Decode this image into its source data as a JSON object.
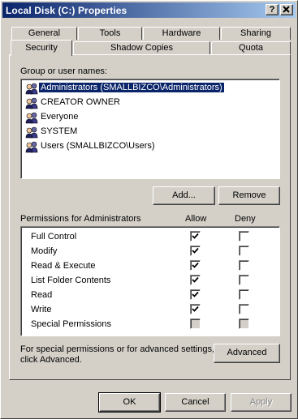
{
  "window": {
    "title": "Local Disk (C:) Properties",
    "help_button": "?",
    "close_button": "X"
  },
  "tabs_row1": [
    {
      "label": "General"
    },
    {
      "label": "Tools"
    },
    {
      "label": "Hardware"
    },
    {
      "label": "Sharing"
    }
  ],
  "tabs_row2": [
    {
      "label": "Security",
      "active": true
    },
    {
      "label": "Shadow Copies"
    },
    {
      "label": "Quota"
    }
  ],
  "security": {
    "group_label": "Group or user names:",
    "users": [
      {
        "name": "Administrators (SMALLBIZCO\\Administrators)",
        "selected": true,
        "icon": "user-group-icon"
      },
      {
        "name": "CREATOR OWNER",
        "icon": "user-group-icon"
      },
      {
        "name": "Everyone",
        "icon": "user-group-icon"
      },
      {
        "name": "SYSTEM",
        "icon": "user-group-icon"
      },
      {
        "name": "Users (SMALLBIZCO\\Users)",
        "icon": "user-group-icon"
      }
    ],
    "add_button": "Add...",
    "remove_button": "Remove",
    "permissions_label": "Permissions for Administrators",
    "allow_header": "Allow",
    "deny_header": "Deny",
    "permissions": [
      {
        "name": "Full Control",
        "allow": true,
        "deny": false
      },
      {
        "name": "Modify",
        "allow": true,
        "deny": false
      },
      {
        "name": "Read & Execute",
        "allow": true,
        "deny": false
      },
      {
        "name": "List Folder Contents",
        "allow": true,
        "deny": false
      },
      {
        "name": "Read",
        "allow": true,
        "deny": false
      },
      {
        "name": "Write",
        "allow": true,
        "deny": false
      },
      {
        "name": "Special Permissions",
        "allow": false,
        "deny": false,
        "disabled": true
      }
    ],
    "advanced_note_line1": "For special permissions or for advanced settings,",
    "advanced_note_line2": "click Advanced.",
    "advanced_button": "Advanced"
  },
  "footer": {
    "ok_button": "OK",
    "cancel_button": "Cancel",
    "apply_button": "Apply",
    "apply_disabled": true
  }
}
